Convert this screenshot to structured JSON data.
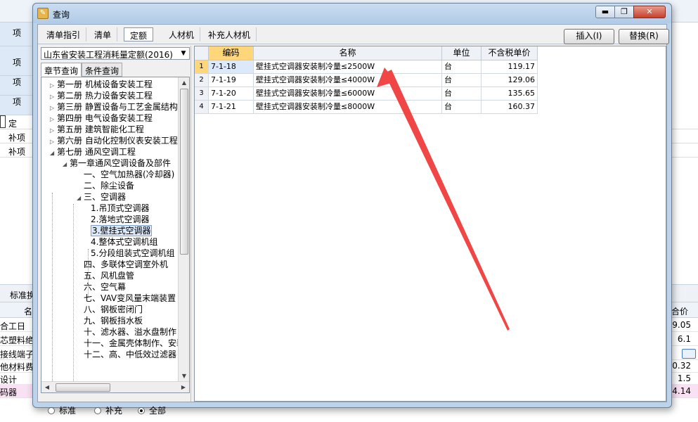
{
  "window": {
    "title": "查询",
    "buttons": {
      "min": "▬",
      "max": "❐",
      "close": "✕"
    }
  },
  "toolbar": {
    "tabs": [
      "清单指引",
      "清单",
      "定额",
      "人材机",
      "补充人材机"
    ],
    "active_tab": "定额",
    "insert_label": "插入(I)",
    "replace_label": "替换(R)"
  },
  "left": {
    "quota_set": "山东省安装工程消耗量定额(2016)",
    "subtabs": [
      "章节查询",
      "条件查询"
    ],
    "tree": [
      {
        "label": "第一册 机械设备安装工程",
        "level": 0,
        "arrow": "▷"
      },
      {
        "label": "第二册 热力设备安装工程",
        "level": 0,
        "arrow": "▷"
      },
      {
        "label": "第三册 静置设备与工艺金属结构",
        "level": 0,
        "arrow": "▷"
      },
      {
        "label": "第四册 电气设备安装工程",
        "level": 0,
        "arrow": "▷"
      },
      {
        "label": "第五册 建筑智能化工程",
        "level": 0,
        "arrow": "▷"
      },
      {
        "label": "第六册 自动化控制仪表安装工程",
        "level": 0,
        "arrow": "▷"
      },
      {
        "label": "第七册 通风空调工程",
        "level": 0,
        "arrow": "◢"
      },
      {
        "label": "第一章通风空调设备及部件",
        "level": 1,
        "arrow": "◢"
      },
      {
        "label": "一、空气加热器(冷却器)",
        "level": 2,
        "arrow": ""
      },
      {
        "label": "二、除尘设备",
        "level": 2,
        "arrow": ""
      },
      {
        "label": "三、空调器",
        "level": 2,
        "arrow": "◢"
      },
      {
        "label": "1.吊顶式空调器",
        "level": 3,
        "arrow": ""
      },
      {
        "label": "2.落地式空调器",
        "level": 3,
        "arrow": ""
      },
      {
        "label": "3.壁挂式空调器",
        "level": 3,
        "arrow": "",
        "selected": true
      },
      {
        "label": "4.整体式空调机组",
        "level": 3,
        "arrow": ""
      },
      {
        "label": "5.分段组装式空调机组",
        "level": 3,
        "arrow": ""
      },
      {
        "label": "四、多联体空调室外机",
        "level": 2,
        "arrow": ""
      },
      {
        "label": "五、风机盘管",
        "level": 2,
        "arrow": ""
      },
      {
        "label": "六、空气幕",
        "level": 2,
        "arrow": ""
      },
      {
        "label": "七、VAV变风量末端装置",
        "level": 2,
        "arrow": ""
      },
      {
        "label": "八、钢板密闭门",
        "level": 2,
        "arrow": ""
      },
      {
        "label": "九、钢板挡水板",
        "level": 2,
        "arrow": ""
      },
      {
        "label": "十、滤水器、溢水盘制作",
        "level": 2,
        "arrow": ""
      },
      {
        "label": "十一、金属壳体制作、安装",
        "level": 2,
        "arrow": ""
      },
      {
        "label": "十二、高、中低效过滤器",
        "level": 2,
        "arrow": ""
      }
    ],
    "radios": [
      "标准",
      "补充",
      "全部"
    ],
    "radio_selected": "全部"
  },
  "grid": {
    "headers": [
      "编码",
      "名称",
      "单位",
      "不含税单价"
    ],
    "rows": [
      {
        "no": "1",
        "code": "7-1-18",
        "name": "壁挂式空调器安装制冷量≤2500W",
        "unit": "台",
        "price": "119.17"
      },
      {
        "no": "2",
        "code": "7-1-19",
        "name": "壁挂式空调器安装制冷量≤4000W",
        "unit": "台",
        "price": "129.06"
      },
      {
        "no": "3",
        "code": "7-1-20",
        "name": "壁挂式空调器安装制冷量≤6000W",
        "unit": "台",
        "price": "135.65"
      },
      {
        "no": "4",
        "code": "7-1-21",
        "name": "壁挂式空调器安装制冷量≤8000W",
        "unit": "台",
        "price": "160.37"
      }
    ],
    "selected_row": 1
  },
  "background": {
    "left_labels": [
      "项",
      "项",
      "项",
      "项"
    ],
    "rows": [
      "定",
      "补项",
      "补项"
    ],
    "lower_tab": "标准换",
    "lower_head": "名",
    "lower_right_head": "合价",
    "lower_rows": [
      {
        "name": "合工日",
        "value": "9.05"
      },
      {
        "name": "芯塑料绝",
        "value": "6.1"
      },
      {
        "name": "接线端子",
        "value": ""
      },
      {
        "name": "他材料费",
        "value": "0.32"
      },
      {
        "name": "设计",
        "value": "1.5"
      },
      {
        "name": "码器",
        "value": "4.14"
      }
    ]
  },
  "colors": {
    "accent": "#ffd67a",
    "arrow": "#f04646",
    "dialog": "#bcd3ea",
    "pink_row": "#f7e1f2"
  }
}
